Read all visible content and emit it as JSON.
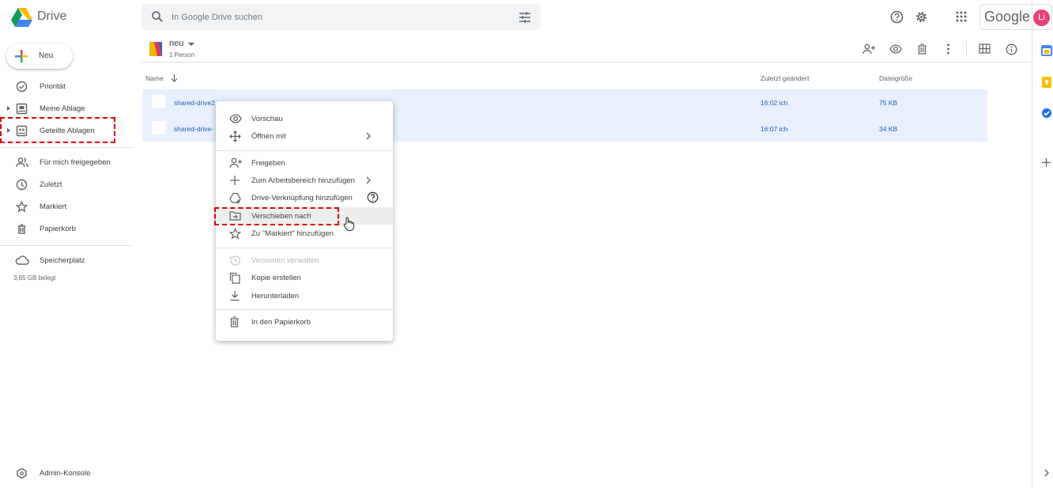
{
  "header": {
    "brand": "Drive",
    "search_placeholder": "In Google Drive suchen",
    "google_word": "Google",
    "avatar_initials": "Li"
  },
  "sidebar": {
    "new_label": "Neu",
    "items": [
      {
        "label": "Priorität",
        "icon": "check-circle-icon"
      },
      {
        "label": "Meine Ablage",
        "icon": "my-drive-icon"
      },
      {
        "label": "Geteilte Ablagen",
        "icon": "shared-drives-icon"
      },
      {
        "label": "Für mich freigegeben",
        "icon": "people-icon"
      },
      {
        "label": "Zuletzt",
        "icon": "clock-icon"
      },
      {
        "label": "Markiert",
        "icon": "star-icon"
      },
      {
        "label": "Papierkorb",
        "icon": "trash-icon"
      },
      {
        "label": "Speicherplatz",
        "icon": "cloud-icon"
      }
    ],
    "storage_used": "3,65 GB belegt",
    "admin_label": "Admin-Konsole"
  },
  "folder": {
    "title": "neu",
    "members": "1 Person"
  },
  "table": {
    "columns": [
      "Name",
      "Zuletzt geändert",
      "Dateigröße"
    ],
    "rows": [
      {
        "name": "shared-drive2",
        "modified": "16:02  ich",
        "size": "75 KB"
      },
      {
        "name": "shared-drive-",
        "modified": "16:07  ich",
        "size": "34 KB"
      }
    ]
  },
  "context_menu": {
    "items": [
      {
        "label": "Vorschau",
        "icon": "eye-icon"
      },
      {
        "label": "Öffnen mit",
        "icon": "move-arrows-icon"
      },
      {
        "label": "Freigeben",
        "icon": "person-add-icon"
      },
      {
        "label": "Zum Arbeitsbereich hinzufügen",
        "icon": "plus-icon"
      },
      {
        "label": "Drive-Verknüpfung hinzufügen",
        "icon": "add-shortcut-icon"
      },
      {
        "label": "Verschieben nach",
        "icon": "move-to-folder-icon"
      },
      {
        "label": "Zu \"Markiert\" hinzufügen",
        "icon": "star-icon"
      },
      {
        "label": "Versionen verwalten",
        "icon": "history-icon"
      },
      {
        "label": "Kopie erstellen",
        "icon": "copy-icon"
      },
      {
        "label": "Herunterladen",
        "icon": "download-icon"
      },
      {
        "label": "In den Papierkorb",
        "icon": "trash-icon"
      }
    ]
  },
  "colors": {
    "accent_blue": "#1a73e8",
    "selection": "#e8f0fe",
    "highlight_red": "#e00000",
    "avatar": "#e8407a"
  }
}
